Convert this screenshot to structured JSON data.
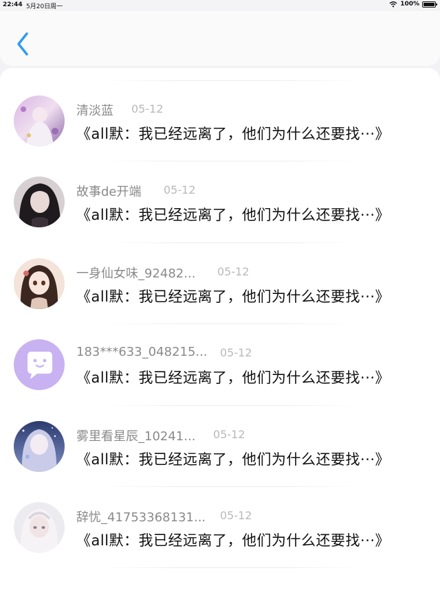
{
  "status_bar": {
    "time": "22:44",
    "date": "5月20日周一",
    "battery": "100%",
    "icons": [
      "wifi-icon",
      "battery-icon"
    ]
  },
  "nav": {
    "back_icon": "chevron-left-icon",
    "accent_color": "#2f9bf0"
  },
  "comments": [
    {
      "user": "清淡蓝",
      "date": "05-12",
      "text": "《all默：我已经远离了，他们为什么还要找···》",
      "avatar_color": "#c9a7d9"
    },
    {
      "user": "故事de开端",
      "date": "05-12",
      "text": "《all默：我已经远离了，他们为什么还要找···》",
      "avatar_color": "#3a3238"
    },
    {
      "user": "一身仙女味_92482...",
      "date": "05-12",
      "text": "《all默：我已经远离了，他们为什么还要找···》",
      "avatar_color": "#e9d2c4"
    },
    {
      "user": "183***633_048215...",
      "date": "05-12",
      "text": "《all默：我已经远离了，他们为什么还要找···》",
      "avatar_color": "#c8b2f2"
    },
    {
      "user": "雾里看星辰_10241...",
      "date": "05-12",
      "text": "《all默：我已经远离了，他们为什么还要找···》",
      "avatar_color": "#4a5a8e"
    },
    {
      "user": "辞忧_41753368131...",
      "date": "05-12",
      "text": "《all默：我已经远离了，他们为什么还要找···》",
      "avatar_color": "#e8e4ea"
    }
  ]
}
